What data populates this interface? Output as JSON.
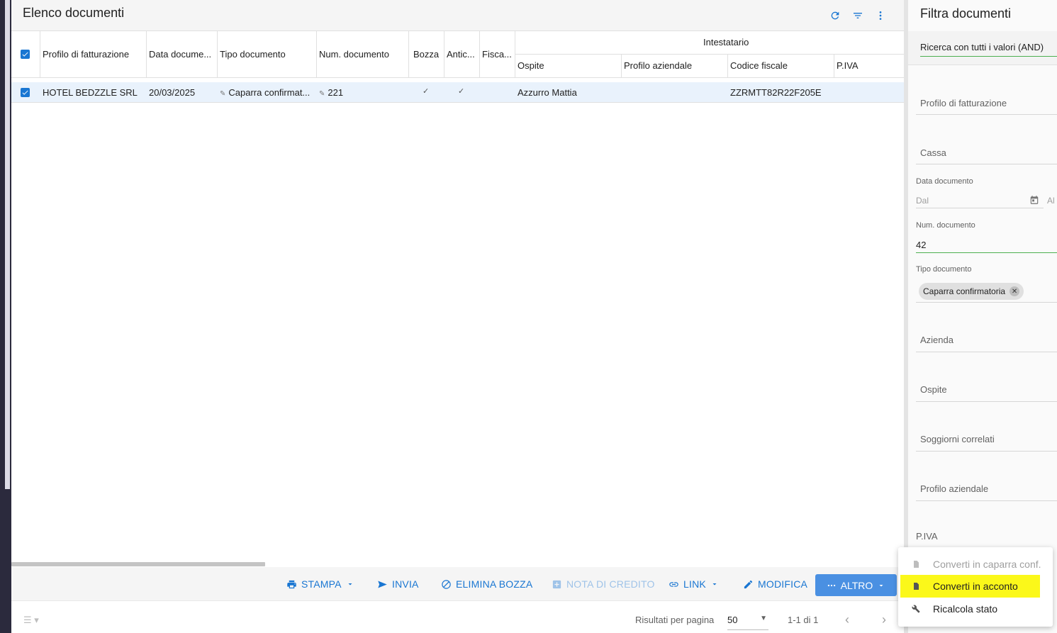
{
  "list": {
    "title": "Elenco documenti",
    "header_icons": [
      "refresh-icon",
      "filter-icon",
      "more-vert-icon"
    ],
    "columns": {
      "profilo": "Profilo di fatturazione",
      "data": "Data docume...",
      "tipo": "Tipo documento",
      "num": "Num. documento",
      "bozza": "Bozza",
      "antic": "Antic...",
      "fisca": "Fisca...",
      "group": "Intestatario",
      "ospite": "Ospite",
      "profilo_aziendale": "Profilo aziendale",
      "codice_fiscale": "Codice fiscale",
      "piva": "P.IVA"
    },
    "rows": [
      {
        "profilo": "HOTEL BEDZZLE SRL",
        "data": "20/03/2025",
        "tipo": "Caparra confirmat...",
        "num": "221",
        "bozza": "✓",
        "antic": "✓",
        "fisca": "",
        "ospite": "Azzurro Mattia",
        "profilo_aziendale": "",
        "codice_fiscale": "ZZRMTT82R22F205E",
        "piva": ""
      }
    ]
  },
  "toolbar": {
    "stampa": "STAMPA",
    "invia": "INVIA",
    "elimina_bozza": "ELIMINA BOZZA",
    "nota_di_credito": "NOTA DI CREDITO",
    "link": "LINK",
    "modifica": "MODIFICA",
    "altro": "ALTRO"
  },
  "footer": {
    "risultati_label": "Risultati per pagina",
    "per_page": "50",
    "range": "1-1 di 1"
  },
  "filter_panel": {
    "title": "Filtra documenti",
    "mode": "Ricerca con tutti i valori (AND)",
    "profilo_fatturazione": "Profilo di fatturazione",
    "cassa": "Cassa",
    "data_documento": "Data documento",
    "dal": "Dal",
    "al": "Al",
    "num_documento_label": "Num. documento",
    "num_documento_value": "42",
    "tipo_documento_label": "Tipo documento",
    "tipo_chip": "Caparra confirmatoria",
    "azienda": "Azienda",
    "ospite": "Ospite",
    "soggiorni": "Soggiorni correlati",
    "profilo_aziendale": "Profilo aziendale",
    "piva": "P.IVA"
  },
  "menu": {
    "items": [
      {
        "label": "Converti in caparra conf.",
        "enabled": false
      },
      {
        "label": "Converti in acconto",
        "enabled": true,
        "highlighted": true
      },
      {
        "label": "Ricalcola stato",
        "enabled": true
      }
    ],
    "highlight_color": "#fbf81a"
  },
  "colors": {
    "accent": "#1976d2",
    "selected_row": "#e9f2fc",
    "altro_button": "#4a90e2"
  }
}
